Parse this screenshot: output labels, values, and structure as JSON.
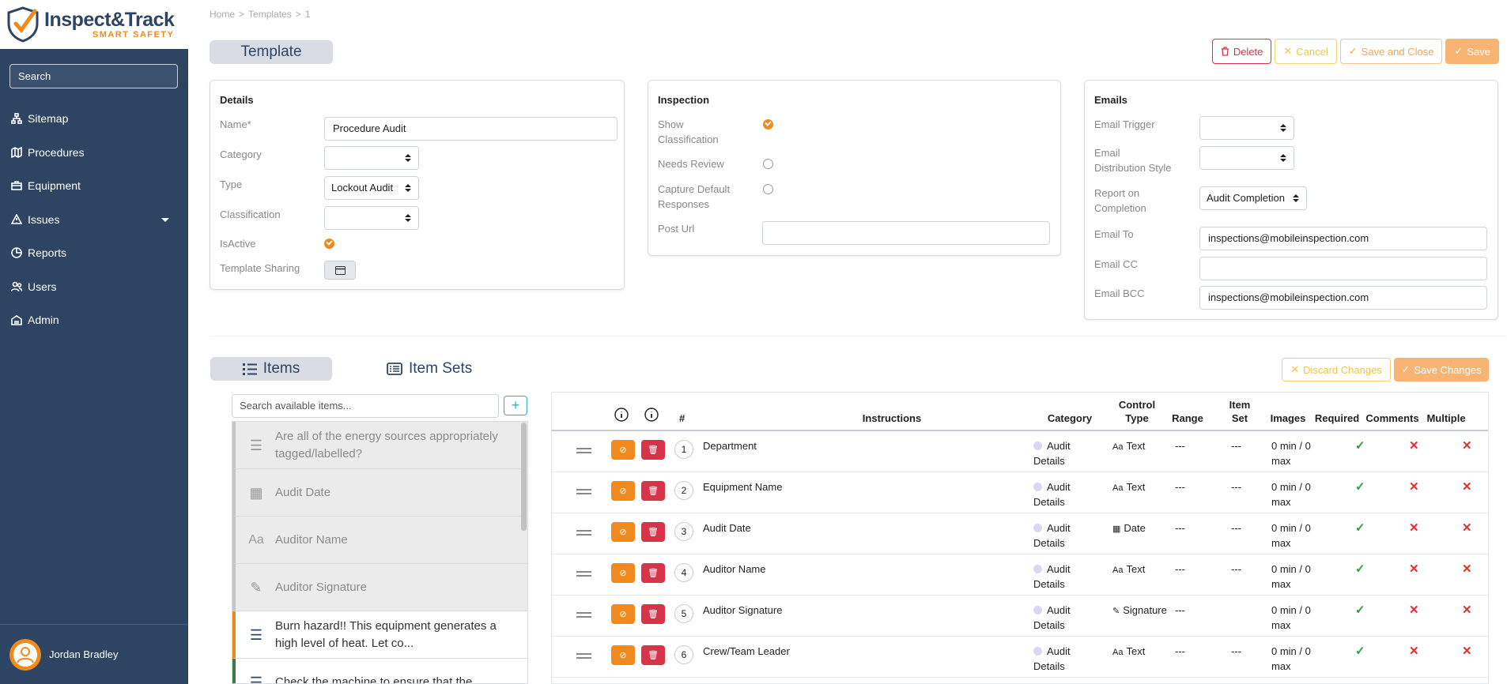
{
  "app": {
    "brand_name": "Inspect&Track",
    "brand_sub": "SMART SAFETY"
  },
  "sidebar": {
    "search_label": "Search",
    "items": [
      {
        "label": "Sitemap",
        "icon": "sitemap-icon"
      },
      {
        "label": "Procedures",
        "icon": "map-icon"
      },
      {
        "label": "Equipment",
        "icon": "toolbox-icon"
      },
      {
        "label": "Issues",
        "icon": "warning-icon"
      },
      {
        "label": "Reports",
        "icon": "chart-pie-icon"
      },
      {
        "label": "Users",
        "icon": "users-icon"
      },
      {
        "label": "Admin",
        "icon": "admin-icon"
      }
    ],
    "user_name": "Jordan Bradley"
  },
  "breadcrumb": [
    "Home",
    "Templates",
    "1"
  ],
  "page_title": "Template",
  "toolbar": {
    "delete": "Delete",
    "cancel": "Cancel",
    "save_close": "Save and Close",
    "save": "Save"
  },
  "details": {
    "heading": "Details",
    "name_label": "Name*",
    "name_value": "Procedure Audit",
    "category_label": "Category",
    "type_label": "Type",
    "type_value": "Lockout Audit",
    "classification_label": "Classification",
    "isactive_label": "IsActive",
    "sharing_label": "Template Sharing"
  },
  "inspection": {
    "heading": "Inspection",
    "show_class_label_1": "Show",
    "show_class_label_2": "Classification",
    "needs_review_label": "Needs Review",
    "capture_label_1": "Capture Default",
    "capture_label_2": "Responses",
    "post_url_label": "Post Url"
  },
  "emails": {
    "heading": "Emails",
    "trigger_label": "Email Trigger",
    "dist_label_1": "Email",
    "dist_label_2": "Distribution Style",
    "report_label_1": "Report on",
    "report_label_2": "Completion",
    "report_value": "Audit Completion",
    "to_label": "Email To",
    "to_value": "inspections@mobileinspection.com",
    "cc_label": "Email CC",
    "bcc_label": "Email BCC",
    "bcc_value": "inspections@mobileinspection.com"
  },
  "items_section": {
    "tab_items": "Items",
    "tab_item_sets": "Item Sets",
    "discard": "Discard Changes",
    "save_changes": "Save Changes",
    "search_placeholder": "Search available items..."
  },
  "available_items": [
    {
      "text": "Are all of the energy sources appropriately tagged/labelled?",
      "state": "used",
      "icon": "list-icon"
    },
    {
      "text": "Audit Date",
      "state": "used",
      "icon": "calendar-icon"
    },
    {
      "text": "Auditor Name",
      "state": "used",
      "icon": "text-icon"
    },
    {
      "text": "Auditor Signature",
      "state": "used",
      "icon": "brush-icon"
    },
    {
      "text": "Burn hazard!! This equipment generates a high level of heat. Let co...",
      "state": "orange",
      "icon": "list-icon"
    },
    {
      "text": "Check the machine to ensure that the",
      "state": "green",
      "icon": "list-icon"
    }
  ],
  "table": {
    "headers": {
      "num": "#",
      "instructions": "Instructions",
      "category": "Category",
      "control_1": "Control",
      "control_2": "Type",
      "range": "Range",
      "itemset_1": "Item",
      "itemset_2": "Set",
      "images": "Images",
      "required": "Required",
      "comments": "Comments",
      "multiple": "Multiple"
    },
    "rows": [
      {
        "num": "1",
        "instructions": "Department",
        "cat1": "Audit",
        "cat2": "Details",
        "control": "Text",
        "control_icon": "Aa",
        "range": "---",
        "itemset": "---",
        "img1": "0 min / 0",
        "img2": "max"
      },
      {
        "num": "2",
        "instructions": "Equipment Name",
        "cat1": "Audit",
        "cat2": "Details",
        "control": "Text",
        "control_icon": "Aa",
        "range": "---",
        "itemset": "---",
        "img1": "0 min / 0",
        "img2": "max"
      },
      {
        "num": "3",
        "instructions": "Audit Date",
        "cat1": "Audit",
        "cat2": "Details",
        "control": "Date",
        "control_icon": "▦",
        "range": "---",
        "itemset": "---",
        "img1": "0 min / 0",
        "img2": "max"
      },
      {
        "num": "4",
        "instructions": "Auditor Name",
        "cat1": "Audit",
        "cat2": "Details",
        "control": "Text",
        "control_icon": "Aa",
        "range": "---",
        "itemset": "---",
        "img1": "0 min / 0",
        "img2": "max"
      },
      {
        "num": "5",
        "instructions": "Auditor Signature",
        "cat1": "Audit",
        "cat2": "Details",
        "control": "Signature",
        "control_icon": "✎",
        "range": "---",
        "itemset": "",
        "img1": "0 min / 0",
        "img2": "max"
      },
      {
        "num": "6",
        "instructions": "Crew/Team Leader",
        "cat1": "Audit",
        "cat2": "Details",
        "control": "Text",
        "control_icon": "Aa",
        "range": "---",
        "itemset": "---",
        "img1": "0 min / 0",
        "img2": "max"
      }
    ]
  },
  "colors": {
    "sidebar": "#2d4563",
    "accent": "#f08a1c",
    "danger": "#d9334a"
  }
}
